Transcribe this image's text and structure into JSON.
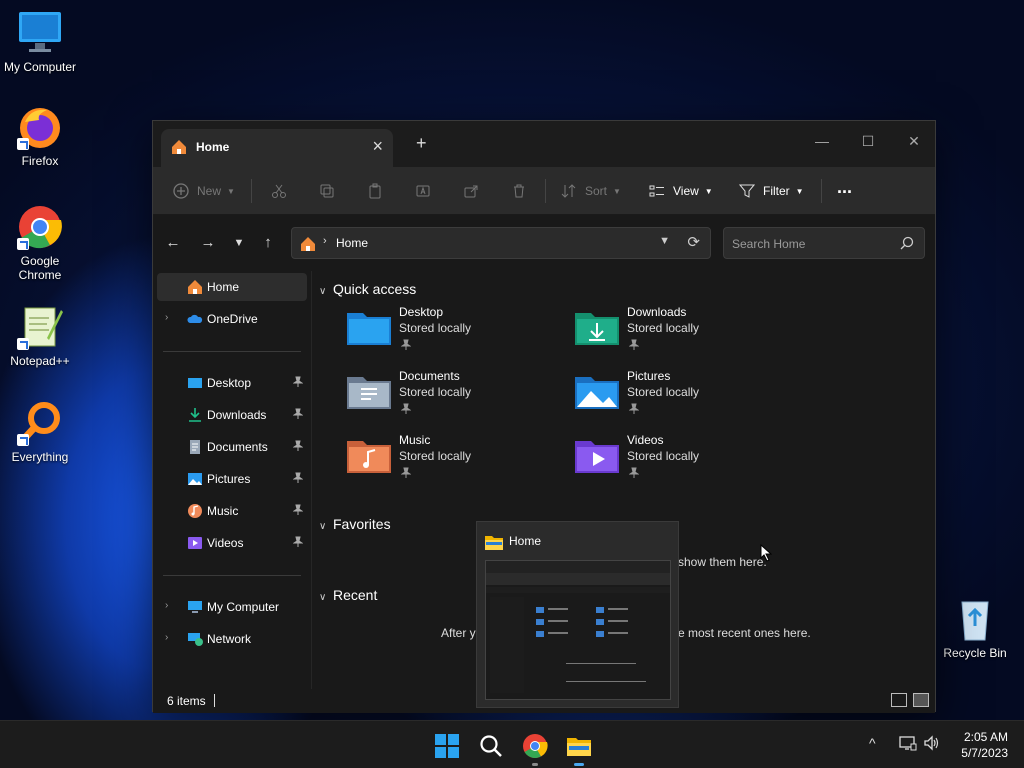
{
  "desktop": {
    "icons": [
      {
        "label": "My Computer",
        "icon": "computer-icon"
      },
      {
        "label": "Firefox",
        "icon": "firefox-icon"
      },
      {
        "label": "Google Chrome",
        "icon": "chrome-icon"
      },
      {
        "label": "Notepad++",
        "icon": "notepadpp-icon"
      },
      {
        "label": "Everything",
        "icon": "everything-icon"
      },
      {
        "label": "Recycle Bin",
        "icon": "recycle-bin-icon"
      }
    ]
  },
  "window": {
    "tab_title": "Home",
    "new_tab": "+",
    "toolbar": {
      "new_label": "New",
      "sort_label": "Sort",
      "view_label": "View",
      "filter_label": "Filter",
      "more_label": "..."
    },
    "address": {
      "path": "Home",
      "search_placeholder": "Search Home"
    },
    "sidebar": {
      "top": [
        {
          "label": "Home",
          "icon": "home-icon",
          "active": true
        },
        {
          "label": "OneDrive",
          "icon": "onedrive-icon"
        }
      ],
      "pinned": [
        {
          "label": "Desktop",
          "icon": "desktop-folder-icon"
        },
        {
          "label": "Downloads",
          "icon": "download-icon"
        },
        {
          "label": "Documents",
          "icon": "documents-icon"
        },
        {
          "label": "Pictures",
          "icon": "pictures-icon"
        },
        {
          "label": "Music",
          "icon": "music-icon"
        },
        {
          "label": "Videos",
          "icon": "videos-icon"
        }
      ],
      "bottom": [
        {
          "label": "My Computer",
          "icon": "computer-icon"
        },
        {
          "label": "Network",
          "icon": "network-icon"
        }
      ]
    },
    "content": {
      "quick_access_title": "Quick access",
      "favorites_title": "Favorites",
      "recent_title": "Recent",
      "folders": [
        {
          "name": "Desktop",
          "status": "Stored locally",
          "color": "#2aa3f0"
        },
        {
          "name": "Downloads",
          "status": "Stored locally",
          "color": "#1fae8a"
        },
        {
          "name": "Documents",
          "status": "Stored locally",
          "color": "#8aa0b8"
        },
        {
          "name": "Pictures",
          "status": "Stored locally",
          "color": "#2a9bf0"
        },
        {
          "name": "Music",
          "status": "Stored locally",
          "color": "#f08a5a"
        },
        {
          "name": "Videos",
          "status": "Stored locally",
          "color": "#8a5af0"
        }
      ],
      "favorites_hint_visible": "show them here.",
      "recent_hint_left": "After y",
      "recent_hint_right": "e most recent ones here."
    },
    "status": {
      "items": "6 items"
    }
  },
  "preview": {
    "title": "Home"
  },
  "taskbar": {
    "clock_time": "2:05 AM",
    "clock_date": "5/7/2023"
  }
}
